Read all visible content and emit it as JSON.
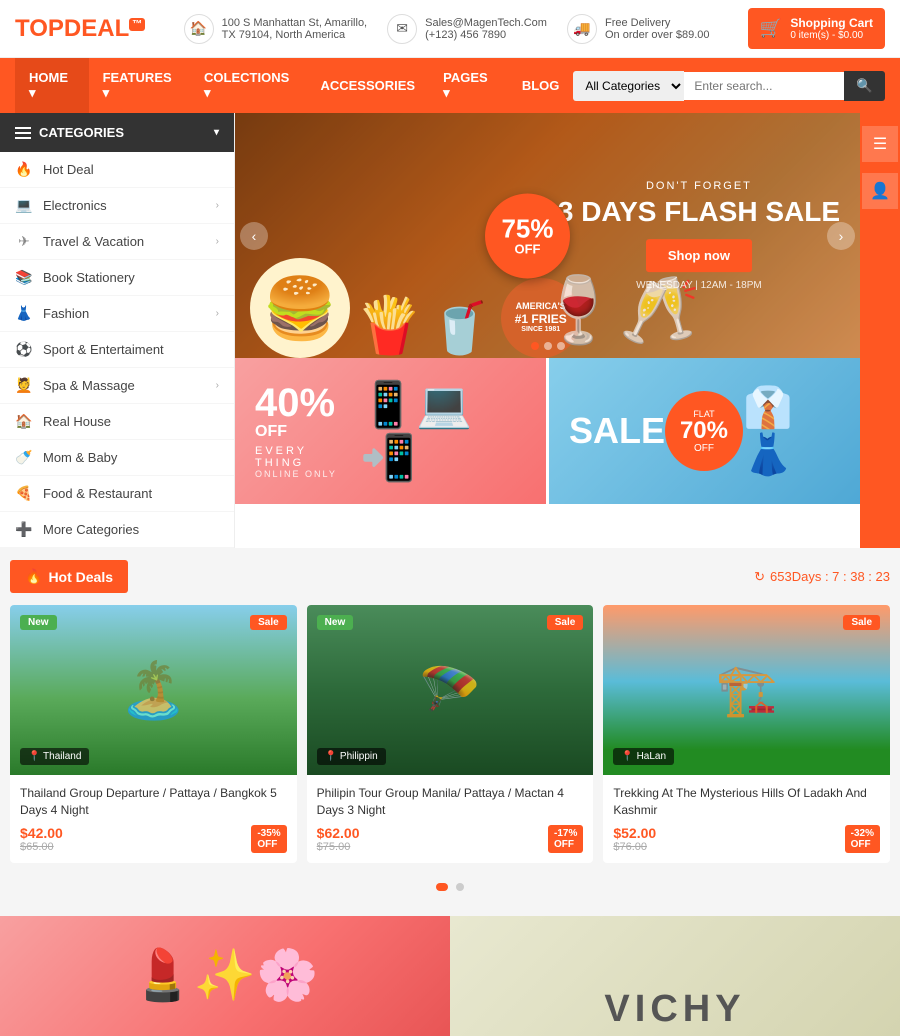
{
  "topbar": {
    "logo_top": "TOP",
    "logo_bottom": "DEAL",
    "logo_tag": "™",
    "address_icon": "🏠",
    "address_line1": "100 S Manhattan St, Amarillo,",
    "address_line2": "TX 79104, North America",
    "email_icon": "✉",
    "email_line1": "Sales@MagenTech.Com",
    "email_line2": "(+123) 456 7890",
    "delivery_icon": "🚚",
    "delivery_line1": "Free Delivery",
    "delivery_line2": "On order over $89.00",
    "cart_label": "Shopping Cart",
    "cart_items": "0 item(s) - $0.00"
  },
  "nav": {
    "items": [
      {
        "label": "HOME",
        "arrow": true
      },
      {
        "label": "FEATURES",
        "arrow": true
      },
      {
        "label": "COLECTIONS",
        "arrow": true
      },
      {
        "label": "ACCESSORIES",
        "arrow": false
      },
      {
        "label": "PAGES",
        "arrow": true
      },
      {
        "label": "BLOG",
        "arrow": false
      }
    ],
    "search_placeholder": "Enter search...",
    "search_category": "All Categories"
  },
  "sidebar": {
    "header": "CATEGORIES",
    "items": [
      {
        "icon": "🔥",
        "label": "Hot Deal",
        "arrow": false
      },
      {
        "icon": "💻",
        "label": "Electronics",
        "arrow": true
      },
      {
        "icon": "✈",
        "label": "Travel & Vacation",
        "arrow": true
      },
      {
        "icon": "📚",
        "label": "Book Stationery",
        "arrow": false
      },
      {
        "icon": "👗",
        "label": "Fashion",
        "arrow": true
      },
      {
        "icon": "⚽",
        "label": "Sport & Entertaiment",
        "arrow": false
      },
      {
        "icon": "💆",
        "label": "Spa & Massage",
        "arrow": true
      },
      {
        "icon": "🏠",
        "label": "Real House",
        "arrow": false
      },
      {
        "icon": "🍼",
        "label": "Mom & Baby",
        "arrow": false
      },
      {
        "icon": "🍕",
        "label": "Food & Restaurant",
        "arrow": false
      },
      {
        "icon": "➕",
        "label": "More Categories",
        "arrow": false
      }
    ]
  },
  "hero": {
    "subtitle": "DON'T FORGET",
    "title": "3 DAYS FLASH SALE",
    "btn_label": "Shop now",
    "date": "WENESDAY | 12AM - 18PM",
    "badge_pct": "75%",
    "badge_off": "OFF"
  },
  "promo_left": {
    "percent": "40%",
    "off": "OFF",
    "line1": "EVERY THING",
    "line2": "ONLINE ONLY"
  },
  "promo_right": {
    "sale": "SALE",
    "flat": "FLAT",
    "pct": "70%",
    "off": "OFF"
  },
  "hot_deals": {
    "title": "Hot Deals",
    "timer_label": "653Days : 7 : 38 : 23"
  },
  "products": [
    {
      "badge_new": "New",
      "badge_sale": "Sale",
      "location": "Thailand",
      "name": "Thailand Group Departure / Pattaya / Bangkok 5 Days 4 Night",
      "price": "$42.00",
      "original": "$65.00",
      "discount": "-35% OFF",
      "color_top": "#87CEEB",
      "color_mid": "#3a8c3a",
      "color_bot": "#1a5c1a"
    },
    {
      "badge_new": "New",
      "badge_sale": "Sale",
      "location": "Philippin",
      "name": "Philipin Tour Group Manila/ Pattaya / Mactan 4 Days 3 Night",
      "price": "$62.00",
      "original": "$75.00",
      "discount": "-17% OFF",
      "color_top": "#4a8c5a",
      "color_mid": "#2d6a3a",
      "color_bot": "#1a4a22"
    },
    {
      "badge_new": "",
      "badge_sale": "Sale",
      "location": "HaLan",
      "name": "Trekking At The Mysterious Hills Of Ladakh And Kashmir",
      "price": "$52.00",
      "original": "$76.00",
      "discount": "-32% OFF",
      "color_top": "#ffaa80",
      "color_mid": "#5abcd8",
      "color_bot": "#2a8a3a"
    }
  ],
  "vichy": {
    "text": "VICHY"
  }
}
